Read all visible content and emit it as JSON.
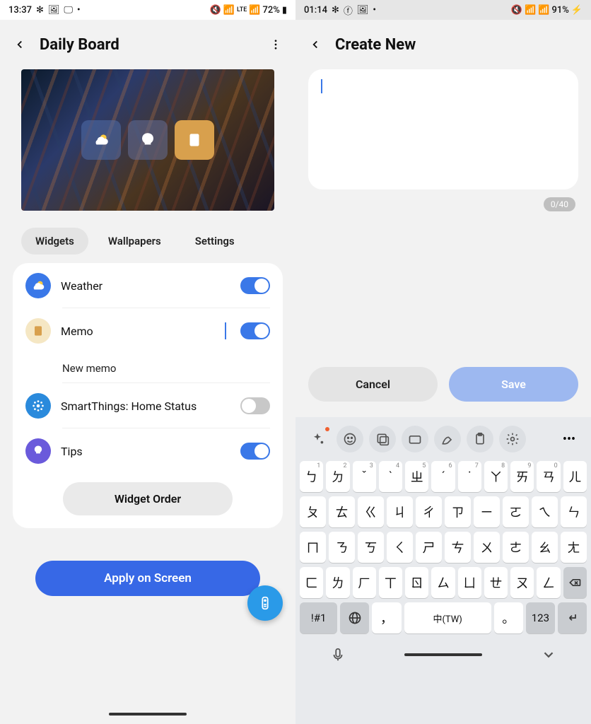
{
  "left": {
    "status": {
      "time": "13:37",
      "battery": "72%",
      "lte": "LTE"
    },
    "title": "Daily Board",
    "tabs": [
      "Widgets",
      "Wallpapers",
      "Settings"
    ],
    "widgets": [
      {
        "name": "Weather",
        "on": true
      },
      {
        "name": "Memo",
        "on": true,
        "sub": "New memo"
      },
      {
        "name": "SmartThings: Home Status",
        "on": false
      },
      {
        "name": "Tips",
        "on": true
      }
    ],
    "order_button": "Widget Order",
    "apply_button": "Apply on Screen"
  },
  "right": {
    "status": {
      "time": "01:14",
      "battery": "91%"
    },
    "title": "Create New",
    "counter": "0/40",
    "cancel": "Cancel",
    "save": "Save",
    "keyboard": {
      "space_label": "中(TW)",
      "symbol_key": "!#1",
      "numeric_key": "123",
      "rows": [
        [
          [
            "ㄅ",
            "1"
          ],
          [
            "ㄉ",
            "2"
          ],
          [
            "ˇ",
            "3"
          ],
          [
            "ˋ",
            "4"
          ],
          [
            "ㄓ",
            "5"
          ],
          [
            "ˊ",
            "6"
          ],
          [
            "˙",
            "7"
          ],
          [
            "ㄚ",
            "8"
          ],
          [
            "ㄞ",
            "9"
          ],
          [
            "ㄢ",
            "0"
          ],
          [
            "ㄦ",
            ""
          ]
        ],
        [
          [
            "ㄆ",
            ""
          ],
          [
            "ㄊ",
            ""
          ],
          [
            "ㄍ",
            ""
          ],
          [
            "ㄐ",
            ""
          ],
          [
            "ㄔ",
            ""
          ],
          [
            "ㄗ",
            ""
          ],
          [
            "ㄧ",
            ""
          ],
          [
            "ㄛ",
            ""
          ],
          [
            "ㄟ",
            ""
          ],
          [
            "ㄣ",
            ""
          ]
        ],
        [
          [
            "ㄇ",
            ""
          ],
          [
            "ㄋ",
            ""
          ],
          [
            "ㄎ",
            ""
          ],
          [
            "ㄑ",
            ""
          ],
          [
            "ㄕ",
            ""
          ],
          [
            "ㄘ",
            ""
          ],
          [
            "ㄨ",
            ""
          ],
          [
            "ㄜ",
            ""
          ],
          [
            "ㄠ",
            ""
          ],
          [
            "ㄤ",
            ""
          ]
        ],
        [
          [
            "ㄈ",
            ""
          ],
          [
            "ㄌ",
            ""
          ],
          [
            "ㄏ",
            ""
          ],
          [
            "ㄒ",
            ""
          ],
          [
            "ㄖ",
            ""
          ],
          [
            "ㄙ",
            ""
          ],
          [
            "ㄩ",
            ""
          ],
          [
            "ㄝ",
            ""
          ],
          [
            "ㄡ",
            ""
          ],
          [
            "ㄥ",
            ""
          ]
        ]
      ]
    }
  }
}
